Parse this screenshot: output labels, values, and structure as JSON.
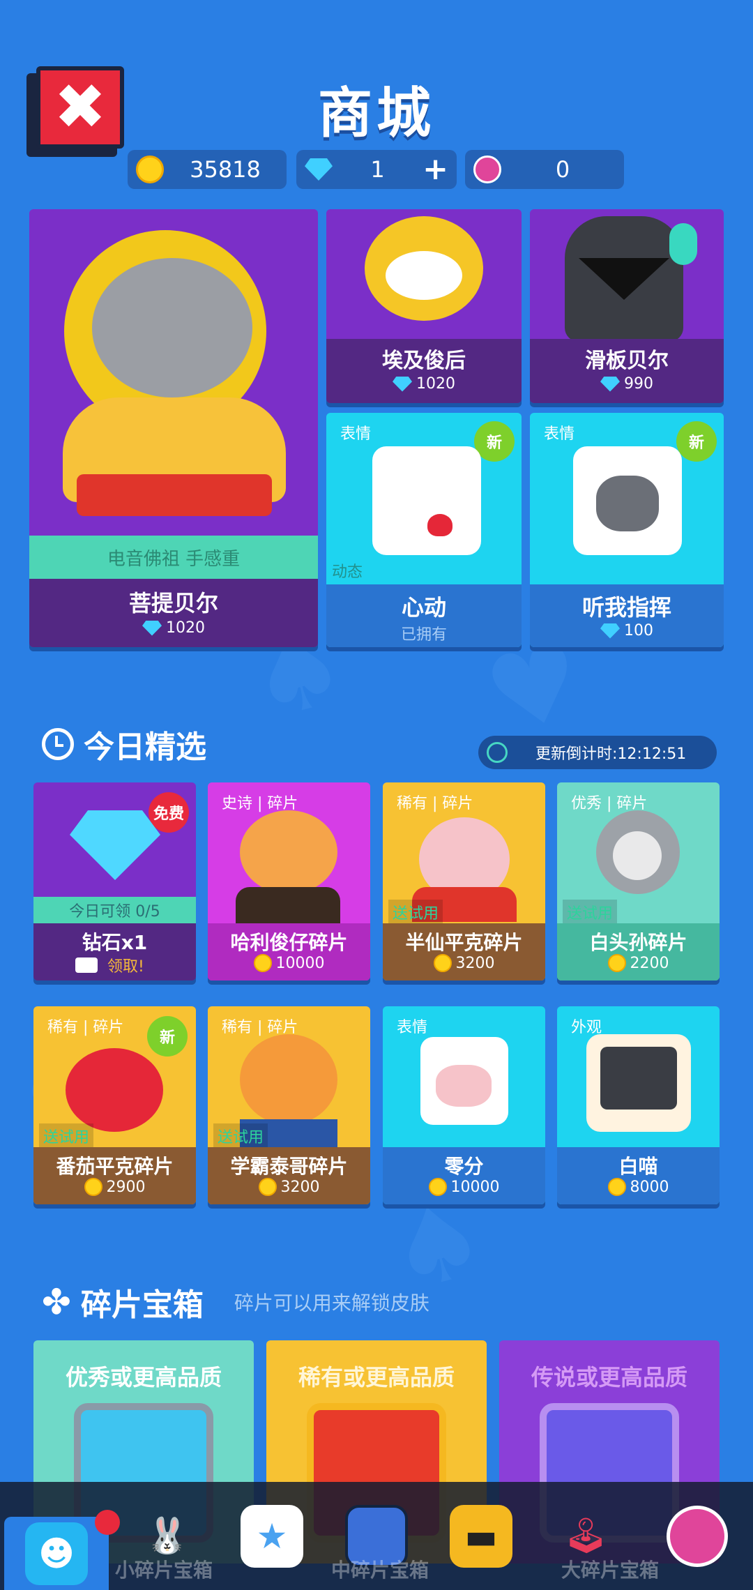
{
  "header": {
    "title": "商城",
    "coins": "35818",
    "diamonds": "1",
    "lotus": "0"
  },
  "featured": {
    "main": {
      "subtitle": "电音佛祖 手感重",
      "name": "菩提贝尔",
      "price": "1020"
    },
    "items": [
      {
        "name": "埃及俊后",
        "price": "1020"
      },
      {
        "name": "滑板贝尔",
        "price": "990"
      },
      {
        "tag": "表情",
        "badge": "新",
        "corner": "动态",
        "name": "心动",
        "status": "已拥有"
      },
      {
        "tag": "表情",
        "badge": "新",
        "name": "听我指挥",
        "price": "100"
      }
    ]
  },
  "daily": {
    "title": "今日精选",
    "countdown": "更新倒计时:12:12:51",
    "items": [
      {
        "badge": "免费",
        "progress": "今日可领 0/5",
        "name": "钻石x1",
        "action": "领取!"
      },
      {
        "tag": "史诗 | 碎片",
        "name": "哈利俊仔碎片",
        "price": "10000"
      },
      {
        "tag": "稀有 | 碎片",
        "trial": "送试用",
        "name": "半仙平克碎片",
        "price": "3200"
      },
      {
        "tag": "优秀 | 碎片",
        "trial": "送试用",
        "name": "白头孙碎片",
        "price": "2200"
      },
      {
        "tag": "稀有 | 碎片",
        "badge": "新",
        "trial": "送试用",
        "name": "番茄平克碎片",
        "price": "2900"
      },
      {
        "tag": "稀有 | 碎片",
        "trial": "送试用",
        "name": "学霸泰哥碎片",
        "price": "3200"
      },
      {
        "tag": "表情",
        "name": "零分",
        "price": "10000"
      },
      {
        "tag": "外观",
        "name": "白喵",
        "price": "8000"
      }
    ]
  },
  "chests": {
    "title": "碎片宝箱",
    "note": "碎片可以用来解锁皮肤",
    "items": [
      {
        "title": "优秀或更高品质",
        "label": "小碎片宝箱"
      },
      {
        "title": "稀有或更高品质",
        "label": "中碎片宝箱"
      },
      {
        "title": "传说或更高品质",
        "label": "大碎片宝箱"
      }
    ]
  },
  "colors": {
    "bg": "#2a7fe4",
    "purple": "#7b2fc8",
    "cyan": "#1ed4f0",
    "yellow": "#f7c233",
    "teal": "#6fd9c8",
    "magenta": "#d63de6"
  }
}
